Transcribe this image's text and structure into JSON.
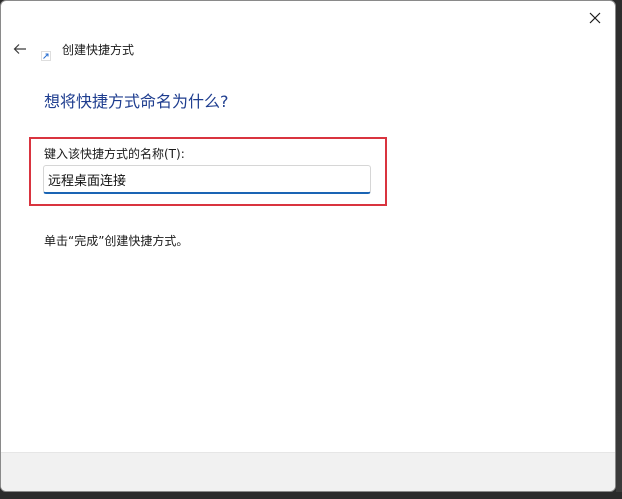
{
  "window": {
    "title": "创建快捷方式"
  },
  "page": {
    "heading": "想将快捷方式命名为什么?",
    "field_label": "键入该快捷方式的名称(T):",
    "field_value": "远程桌面连接",
    "hint": "单击“完成”创建快捷方式。"
  },
  "icons": {
    "back": "back-arrow-icon",
    "app": "shortcut-icon",
    "close": "close-icon"
  },
  "colors": {
    "heading": "#1e3d8f",
    "highlight": "#d9343f",
    "input_focus": "#1a64b4"
  }
}
